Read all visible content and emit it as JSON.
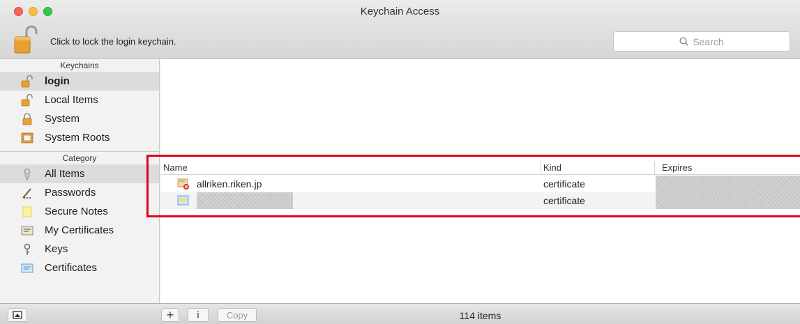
{
  "window": {
    "title": "Keychain Access"
  },
  "toolbar": {
    "lock_text": "Click to lock the login keychain.",
    "search_placeholder": "Search"
  },
  "sidebar": {
    "keychains_header": "Keychains",
    "keychains": [
      {
        "label": "login",
        "icon": "unlocked-padlock-icon",
        "selected": true
      },
      {
        "label": "Local Items",
        "icon": "unlocked-padlock-icon"
      },
      {
        "label": "System",
        "icon": "locked-padlock-icon"
      },
      {
        "label": "System Roots",
        "icon": "cabinet-icon"
      }
    ],
    "category_header": "Category",
    "categories": [
      {
        "label": "All Items",
        "icon": "all-items-icon",
        "selected": true
      },
      {
        "label": "Passwords",
        "icon": "key-pen-icon"
      },
      {
        "label": "Secure Notes",
        "icon": "note-icon"
      },
      {
        "label": "My Certificates",
        "icon": "my-certificate-icon"
      },
      {
        "label": "Keys",
        "icon": "key-icon"
      },
      {
        "label": "Certificates",
        "icon": "certificate-icon"
      }
    ]
  },
  "table": {
    "columns": [
      "Name",
      "Kind",
      "Expires"
    ],
    "rows": [
      {
        "name": "allriken.riken.jp",
        "kind": "certificate",
        "icon": "invalid-certificate-icon",
        "expires_redacted": true
      },
      {
        "name": "",
        "name_redacted": true,
        "kind": "certificate",
        "icon": "certificate-icon",
        "expires_redacted": true
      }
    ]
  },
  "bottom": {
    "add_label": "+",
    "info_label": "i",
    "copy_label": "Copy",
    "item_count": "114 items"
  },
  "colors": {
    "highlight_border": "#e3001b",
    "selection_bg": "#dcdcdc"
  }
}
